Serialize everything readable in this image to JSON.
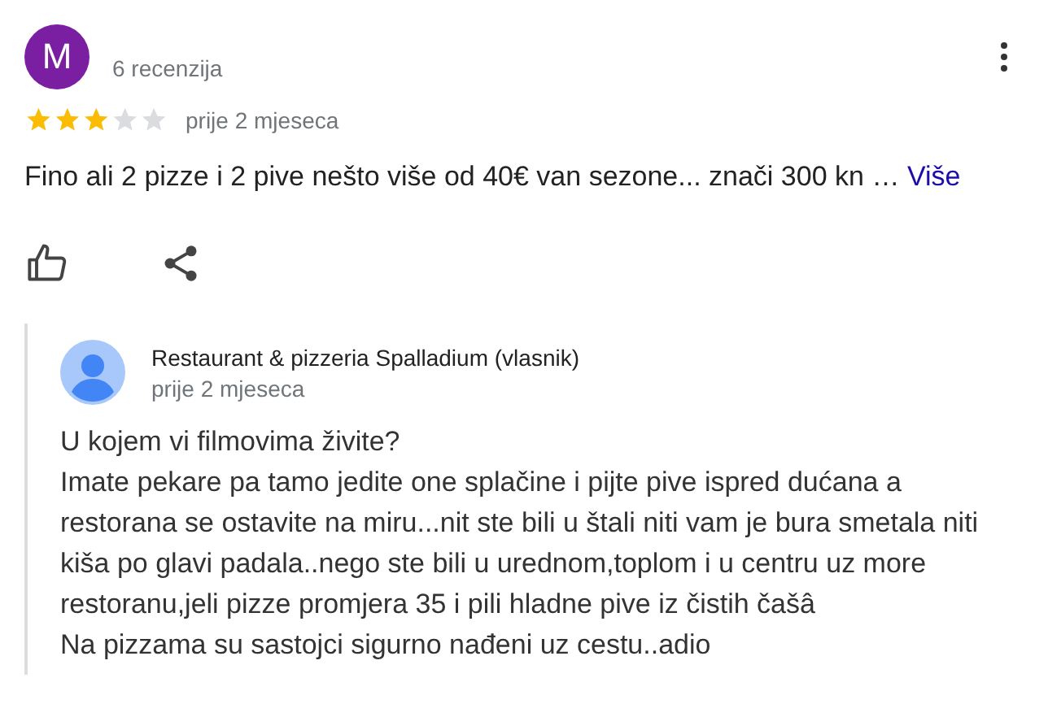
{
  "review": {
    "avatar_letter": "M",
    "review_count": "6 recenzija",
    "stars": 3,
    "date": "prije 2 mjeseca",
    "text": "Fino ali 2 pizze i 2 pive nešto više od 40€ van sezone... znači 300 kn …",
    "more_link": "Više"
  },
  "reply": {
    "author": "Restaurant & pizzeria Spalladium (vlasnik)",
    "date": "prije 2 mjeseca",
    "lines": [
      "U kojem vi filmovima živite?",
      "Imate pekare pa tamo jedite one splačine i pijte pive ispred dućana a restorana se ostavite na miru...nit ste bili u štali niti vam je bura smetala niti kiša po glavi padala..nego ste bili u urednom,toplom i u centru uz more restoranu,jeli pizze promjera 35 i pili hladne pive iz čistih čašâ",
      "Na pizzama su sastojci sigurno nađeni uz cestu..adio"
    ]
  }
}
